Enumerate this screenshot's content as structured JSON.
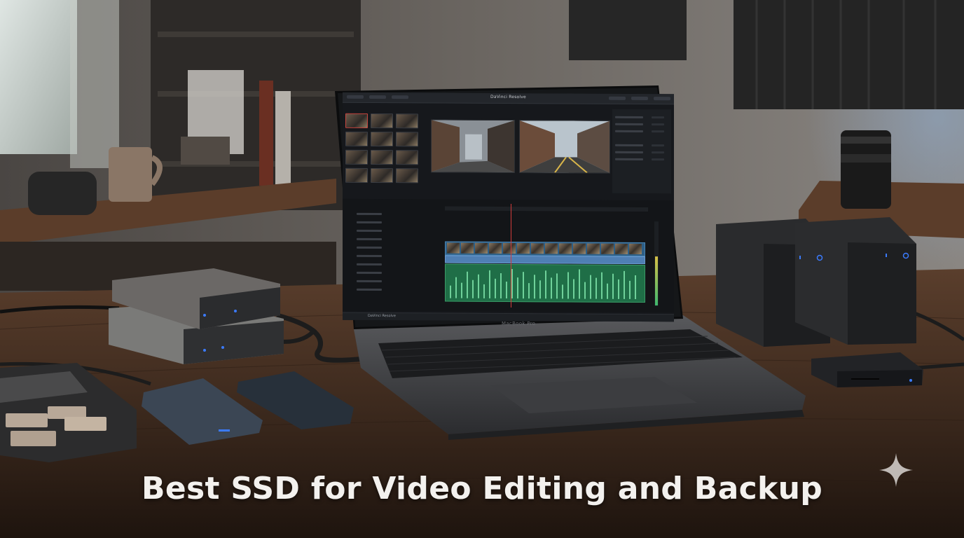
{
  "caption": {
    "text": "Best SSD for Video Editing and Backup"
  },
  "laptop": {
    "lid_brand": "MacBook Pro",
    "app_title": "DaVinci Resolve",
    "app_brand": "DaVinci Resolve"
  },
  "icons": {
    "corner_mark": "sparkle-icon"
  },
  "colors": {
    "caption_text": "#f3f1ee",
    "playhead": "#d23b3b",
    "video_clip": "#2e5f86",
    "audio_clip": "#1f6e47",
    "led": "#3b7bff"
  }
}
